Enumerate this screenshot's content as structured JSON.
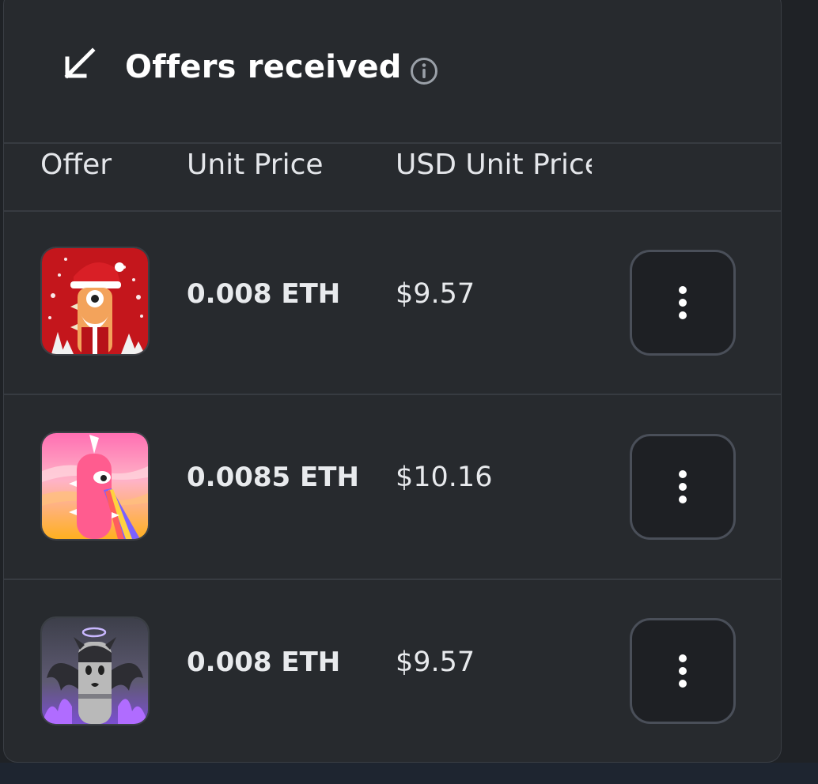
{
  "panel": {
    "title": "Offers received"
  },
  "table": {
    "columns": [
      "Offer",
      "Unit Price",
      "USD Unit Price"
    ],
    "rows": [
      {
        "image": "christmas-creature-nft",
        "unit_price": "0.008 ETH",
        "usd_price": "$9.57"
      },
      {
        "image": "pink-creature-nft",
        "unit_price": "0.0085 ETH",
        "usd_price": "$10.16"
      },
      {
        "image": "dark-winged-creature-nft",
        "unit_price": "0.008 ETH",
        "usd_price": "$9.57"
      }
    ]
  },
  "icons": {
    "header": "arrow-down-left-icon",
    "info": "info-icon",
    "row_action": "more-vertical-icon"
  },
  "colors": {
    "panel_bg": "#272a2e",
    "text": "#e8eaed",
    "button_border": "#4a4f59"
  }
}
